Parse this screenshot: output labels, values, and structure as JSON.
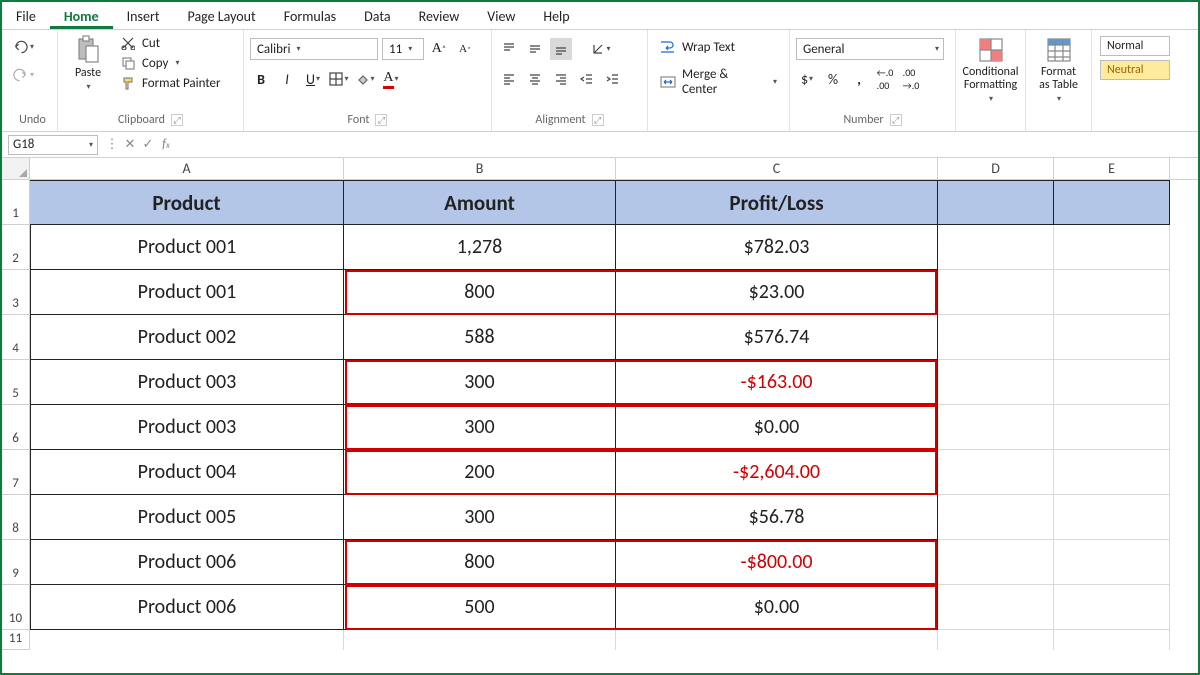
{
  "menu": {
    "file": "File",
    "home": "Home",
    "insert": "Insert",
    "page_layout": "Page Layout",
    "formulas": "Formulas",
    "data": "Data",
    "review": "Review",
    "view": "View",
    "help": "Help"
  },
  "ribbon": {
    "undo_label": "Undo",
    "clipboard": {
      "paste": "Paste",
      "cut": "Cut",
      "copy": "Copy",
      "format_painter": "Format Painter",
      "label": "Clipboard"
    },
    "font": {
      "name": "Calibri",
      "size": "11",
      "label": "Font"
    },
    "alignment": {
      "label": "Alignment",
      "wrap": "Wrap Text",
      "merge": "Merge & Center"
    },
    "number": {
      "format": "General",
      "label": "Number"
    },
    "styles": {
      "cond_fmt": "Conditional Formatting",
      "as_table": "Format as Table",
      "normal": "Normal",
      "neutral": "Neutral"
    }
  },
  "namebox": "G18",
  "formula": "",
  "columns": [
    "A",
    "B",
    "C",
    "D",
    "E"
  ],
  "headers": {
    "A": "Product",
    "B": "Amount",
    "C": "Profit/Loss"
  },
  "rows": [
    {
      "n": "2",
      "A": "Product 001",
      "B": "1,278",
      "C": "$782.03",
      "neg": false,
      "red": false
    },
    {
      "n": "3",
      "A": "Product 001",
      "B": "800",
      "C": "$23.00",
      "neg": false,
      "red": true
    },
    {
      "n": "4",
      "A": "Product 002",
      "B": "588",
      "C": "$576.74",
      "neg": false,
      "red": false
    },
    {
      "n": "5",
      "A": "Product 003",
      "B": "300",
      "C": "-$163.00",
      "neg": true,
      "red": true
    },
    {
      "n": "6",
      "A": "Product 003",
      "B": "300",
      "C": "$0.00",
      "neg": false,
      "red": true
    },
    {
      "n": "7",
      "A": "Product 004",
      "B": "200",
      "C": "-$2,604.00",
      "neg": true,
      "red": true
    },
    {
      "n": "8",
      "A": "Product 005",
      "B": "300",
      "C": "$56.78",
      "neg": false,
      "red": false
    },
    {
      "n": "9",
      "A": "Product 006",
      "B": "800",
      "C": "-$800.00",
      "neg": true,
      "red": true
    },
    {
      "n": "10",
      "A": "Product 006",
      "B": "500",
      "C": "$0.00",
      "neg": false,
      "red": true
    }
  ]
}
